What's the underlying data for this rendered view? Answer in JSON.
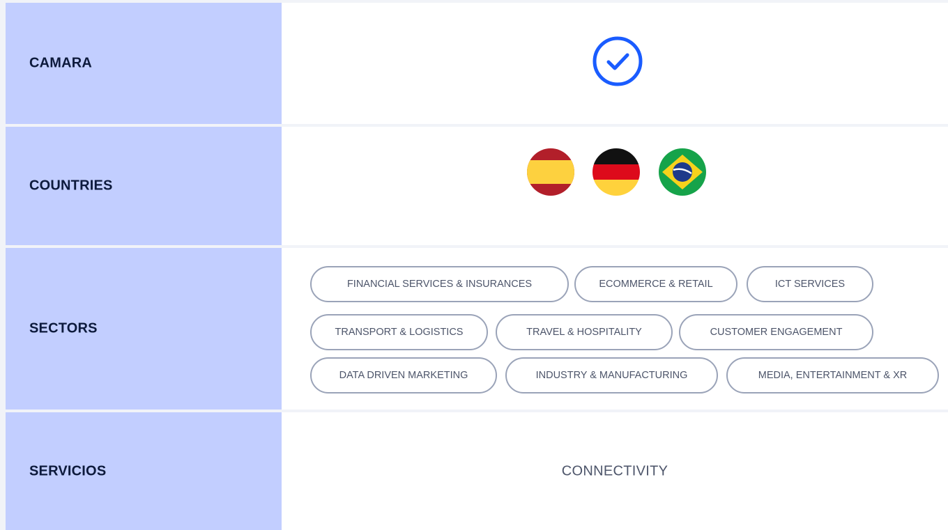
{
  "rows": {
    "camara": {
      "label": "CAMARA",
      "value_icon": "check-circle-icon"
    },
    "countries": {
      "label": "COUNTRIES",
      "flags": [
        "spain-flag-icon",
        "germany-flag-icon",
        "brazil-flag-icon"
      ]
    },
    "sectors": {
      "label": "SECTORS",
      "chips": [
        "FINANCIAL SERVICES & INSURANCES",
        "ECOMMERCE & RETAIL",
        "ICT SERVICES",
        "TRANSPORT & LOGISTICS",
        "TRAVEL & HOSPITALITY",
        "CUSTOMER ENGAGEMENT",
        "DATA DRIVEN MARKETING",
        "INDUSTRY & MANUFACTURING",
        "MEDIA, ENTERTAINMENT & XR"
      ]
    },
    "services": {
      "label": "SERVICIOS",
      "value": "CONNECTIVITY"
    }
  },
  "colors": {
    "label_bg": "#c2ceff",
    "check_blue": "#1a5cff",
    "chip_border": "#9aa3b8",
    "chip_text": "#4d556a"
  }
}
